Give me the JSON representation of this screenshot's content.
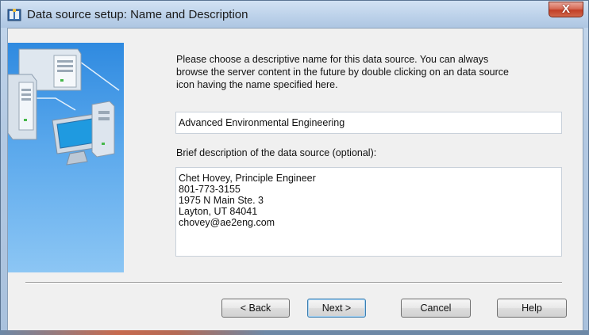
{
  "window": {
    "title": "Data source setup: Name and Description",
    "close_label": "X"
  },
  "intro": {
    "lines": [
      "Please choose a descriptive name for this data source.  You can always",
      "browse the server content in the future by double clicking on an data source",
      "icon having the name specified here."
    ]
  },
  "name_field": {
    "value": "Advanced Environmental Engineering"
  },
  "description": {
    "label": "Brief description of the data source (optional):",
    "lines": [
      "Chet Hovey, Principle Engineer",
      "801-773-3155",
      "1975 N Main Ste. 3",
      "Layton, UT 84041",
      "chovey@ae2eng.com"
    ]
  },
  "buttons": {
    "back": "< Back",
    "next": "Next >",
    "cancel": "Cancel",
    "help": "Help"
  },
  "icons": {
    "app": "data-source-wizard-icon",
    "side": "servers-network-illustration"
  },
  "colors": {
    "side_panel_top": "#2f8ae0",
    "side_panel_bottom": "#8cc6f4",
    "close_button": "#c23f26"
  }
}
